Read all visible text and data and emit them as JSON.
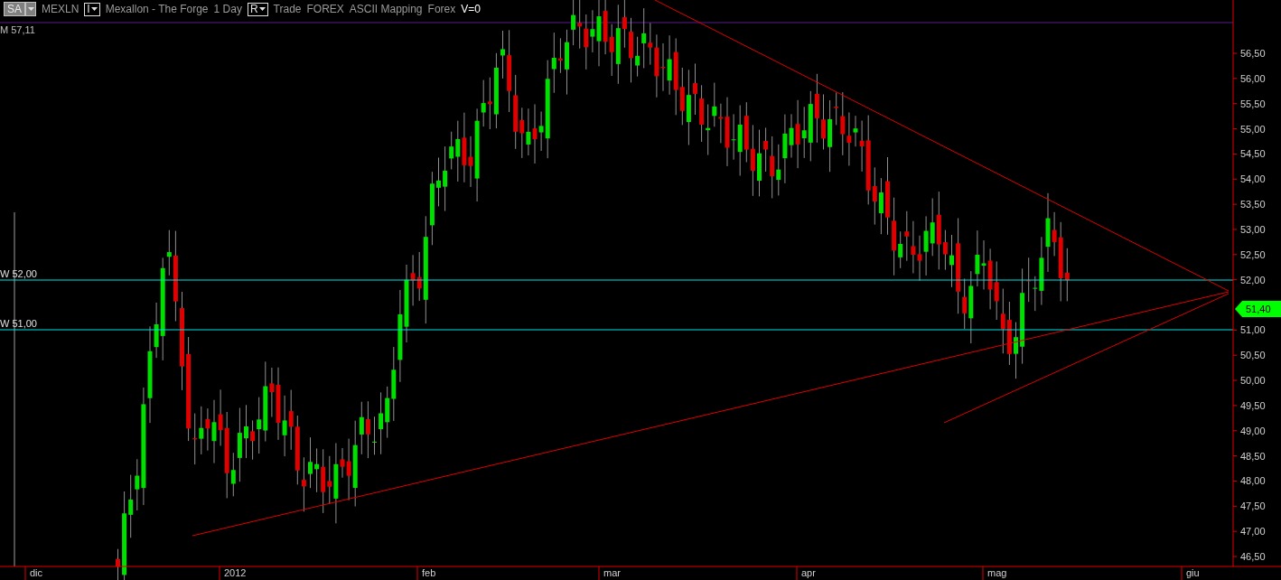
{
  "toolbar": {
    "symbol_box": "SA",
    "symbol": "MEXLN",
    "interval_box": "I",
    "instrument": "Mexallon - The Forge",
    "period": "1 Day",
    "mode_box": "R",
    "items": [
      "Trade",
      "FOREX",
      "ASCII Mapping",
      "Forex"
    ],
    "volume": "V=0"
  },
  "chart": {
    "top_label": "M 57,11",
    "price_levels": [
      {
        "label": "W 52,00"
      },
      {
        "label": "W 51,00"
      }
    ],
    "last_price": "51,40",
    "y_axis": [
      "56,50",
      "56,00",
      "55,50",
      "55,00",
      "54,50",
      "54,00",
      "53,50",
      "53,00",
      "52,50",
      "52,00",
      "51,00",
      "50,50",
      "50,00",
      "49,50",
      "49,00",
      "48,50",
      "48,00",
      "47,50",
      "47,00",
      "46,50"
    ],
    "x_axis": [
      "dic",
      "2012",
      "feb",
      "mar",
      "apr",
      "mag",
      "giu"
    ]
  }
}
